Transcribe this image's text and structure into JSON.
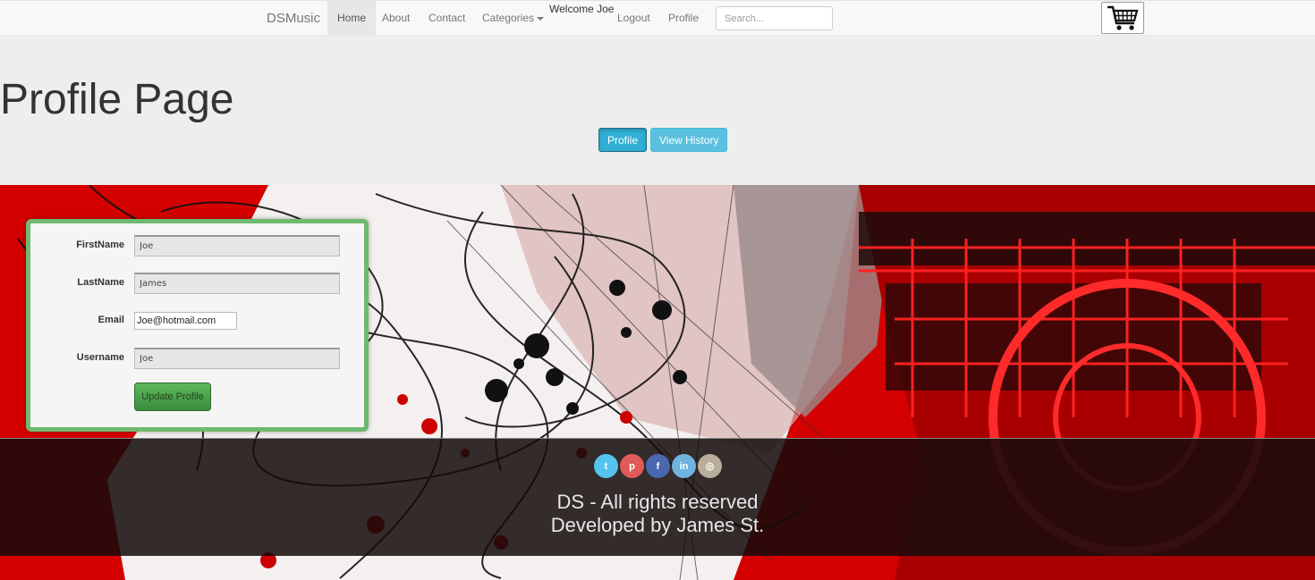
{
  "nav": {
    "brand": "DSMusic",
    "items": [
      {
        "label": "Home"
      },
      {
        "label": "About"
      },
      {
        "label": "Contact"
      },
      {
        "label": "Categories"
      },
      {
        "label": "Logout"
      },
      {
        "label": "Profile"
      }
    ],
    "welcome": "Welcome Joe",
    "search_placeholder": "Search...",
    "cart_icon": "shopping-cart-icon"
  },
  "header": {
    "title": "Profile Page",
    "tabs": [
      {
        "label": "Profile"
      },
      {
        "label": "View History"
      }
    ]
  },
  "form": {
    "fields": [
      {
        "label": "FirstName",
        "value": "Joe"
      },
      {
        "label": "LastName",
        "value": "James"
      },
      {
        "label": "Email",
        "value": "Joe@hotmail.com"
      },
      {
        "label": "Username",
        "value": "Joe"
      }
    ],
    "submit_label": "Update Profile"
  },
  "footer": {
    "socials": [
      {
        "icon": "twitter-icon",
        "glyph": "t",
        "color": "#55c4ec"
      },
      {
        "icon": "pinterest-icon",
        "glyph": "p",
        "color": "#e05a5a"
      },
      {
        "icon": "facebook-icon",
        "glyph": "f",
        "color": "#4a67b1"
      },
      {
        "icon": "linkedin-icon",
        "glyph": "in",
        "color": "#6fb3de"
      },
      {
        "icon": "instagram-icon",
        "glyph": "◎",
        "color": "#b8ae9a"
      }
    ],
    "line1": "DS - All rights reserved",
    "line2": "Developed by James St."
  },
  "colors": {
    "accent": "#5bc0de",
    "success": "#5cb85c",
    "form_border": "#6fb96f",
    "art_red": "#d40000"
  }
}
